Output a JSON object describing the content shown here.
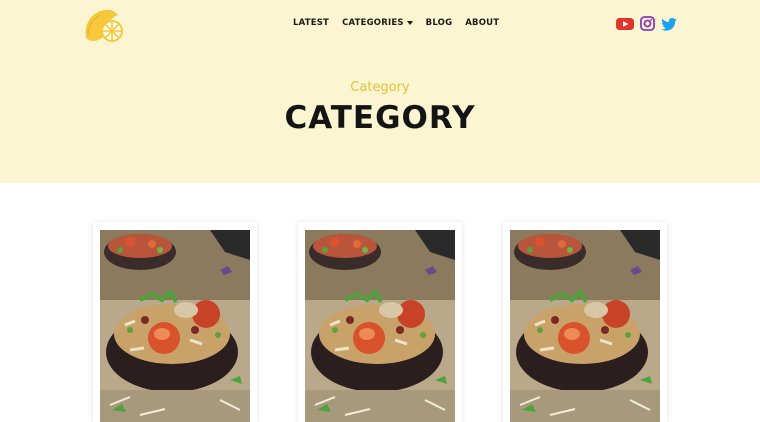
{
  "header": {
    "logo_icon": "lemon-logo-icon",
    "nav": [
      {
        "label": "LATEST",
        "has_dropdown": false
      },
      {
        "label": "CATEGORIES",
        "has_dropdown": true
      },
      {
        "label": "BLOG",
        "has_dropdown": false
      },
      {
        "label": "ABOUT",
        "has_dropdown": false
      }
    ],
    "social": [
      {
        "icon": "youtube-icon",
        "color": "#e1352c"
      },
      {
        "icon": "instagram-icon",
        "color": "#8a3ab9"
      },
      {
        "icon": "twitter-icon",
        "color": "#1da1f2"
      }
    ]
  },
  "hero": {
    "eyebrow": "Category",
    "title": "CATEGORY",
    "background": "#fcf5d2",
    "accent": "#e3c234"
  },
  "posts": [
    {
      "image": "stuffed-mushroom-photo"
    },
    {
      "image": "stuffed-mushroom-photo"
    },
    {
      "image": "stuffed-mushroom-photo"
    }
  ]
}
